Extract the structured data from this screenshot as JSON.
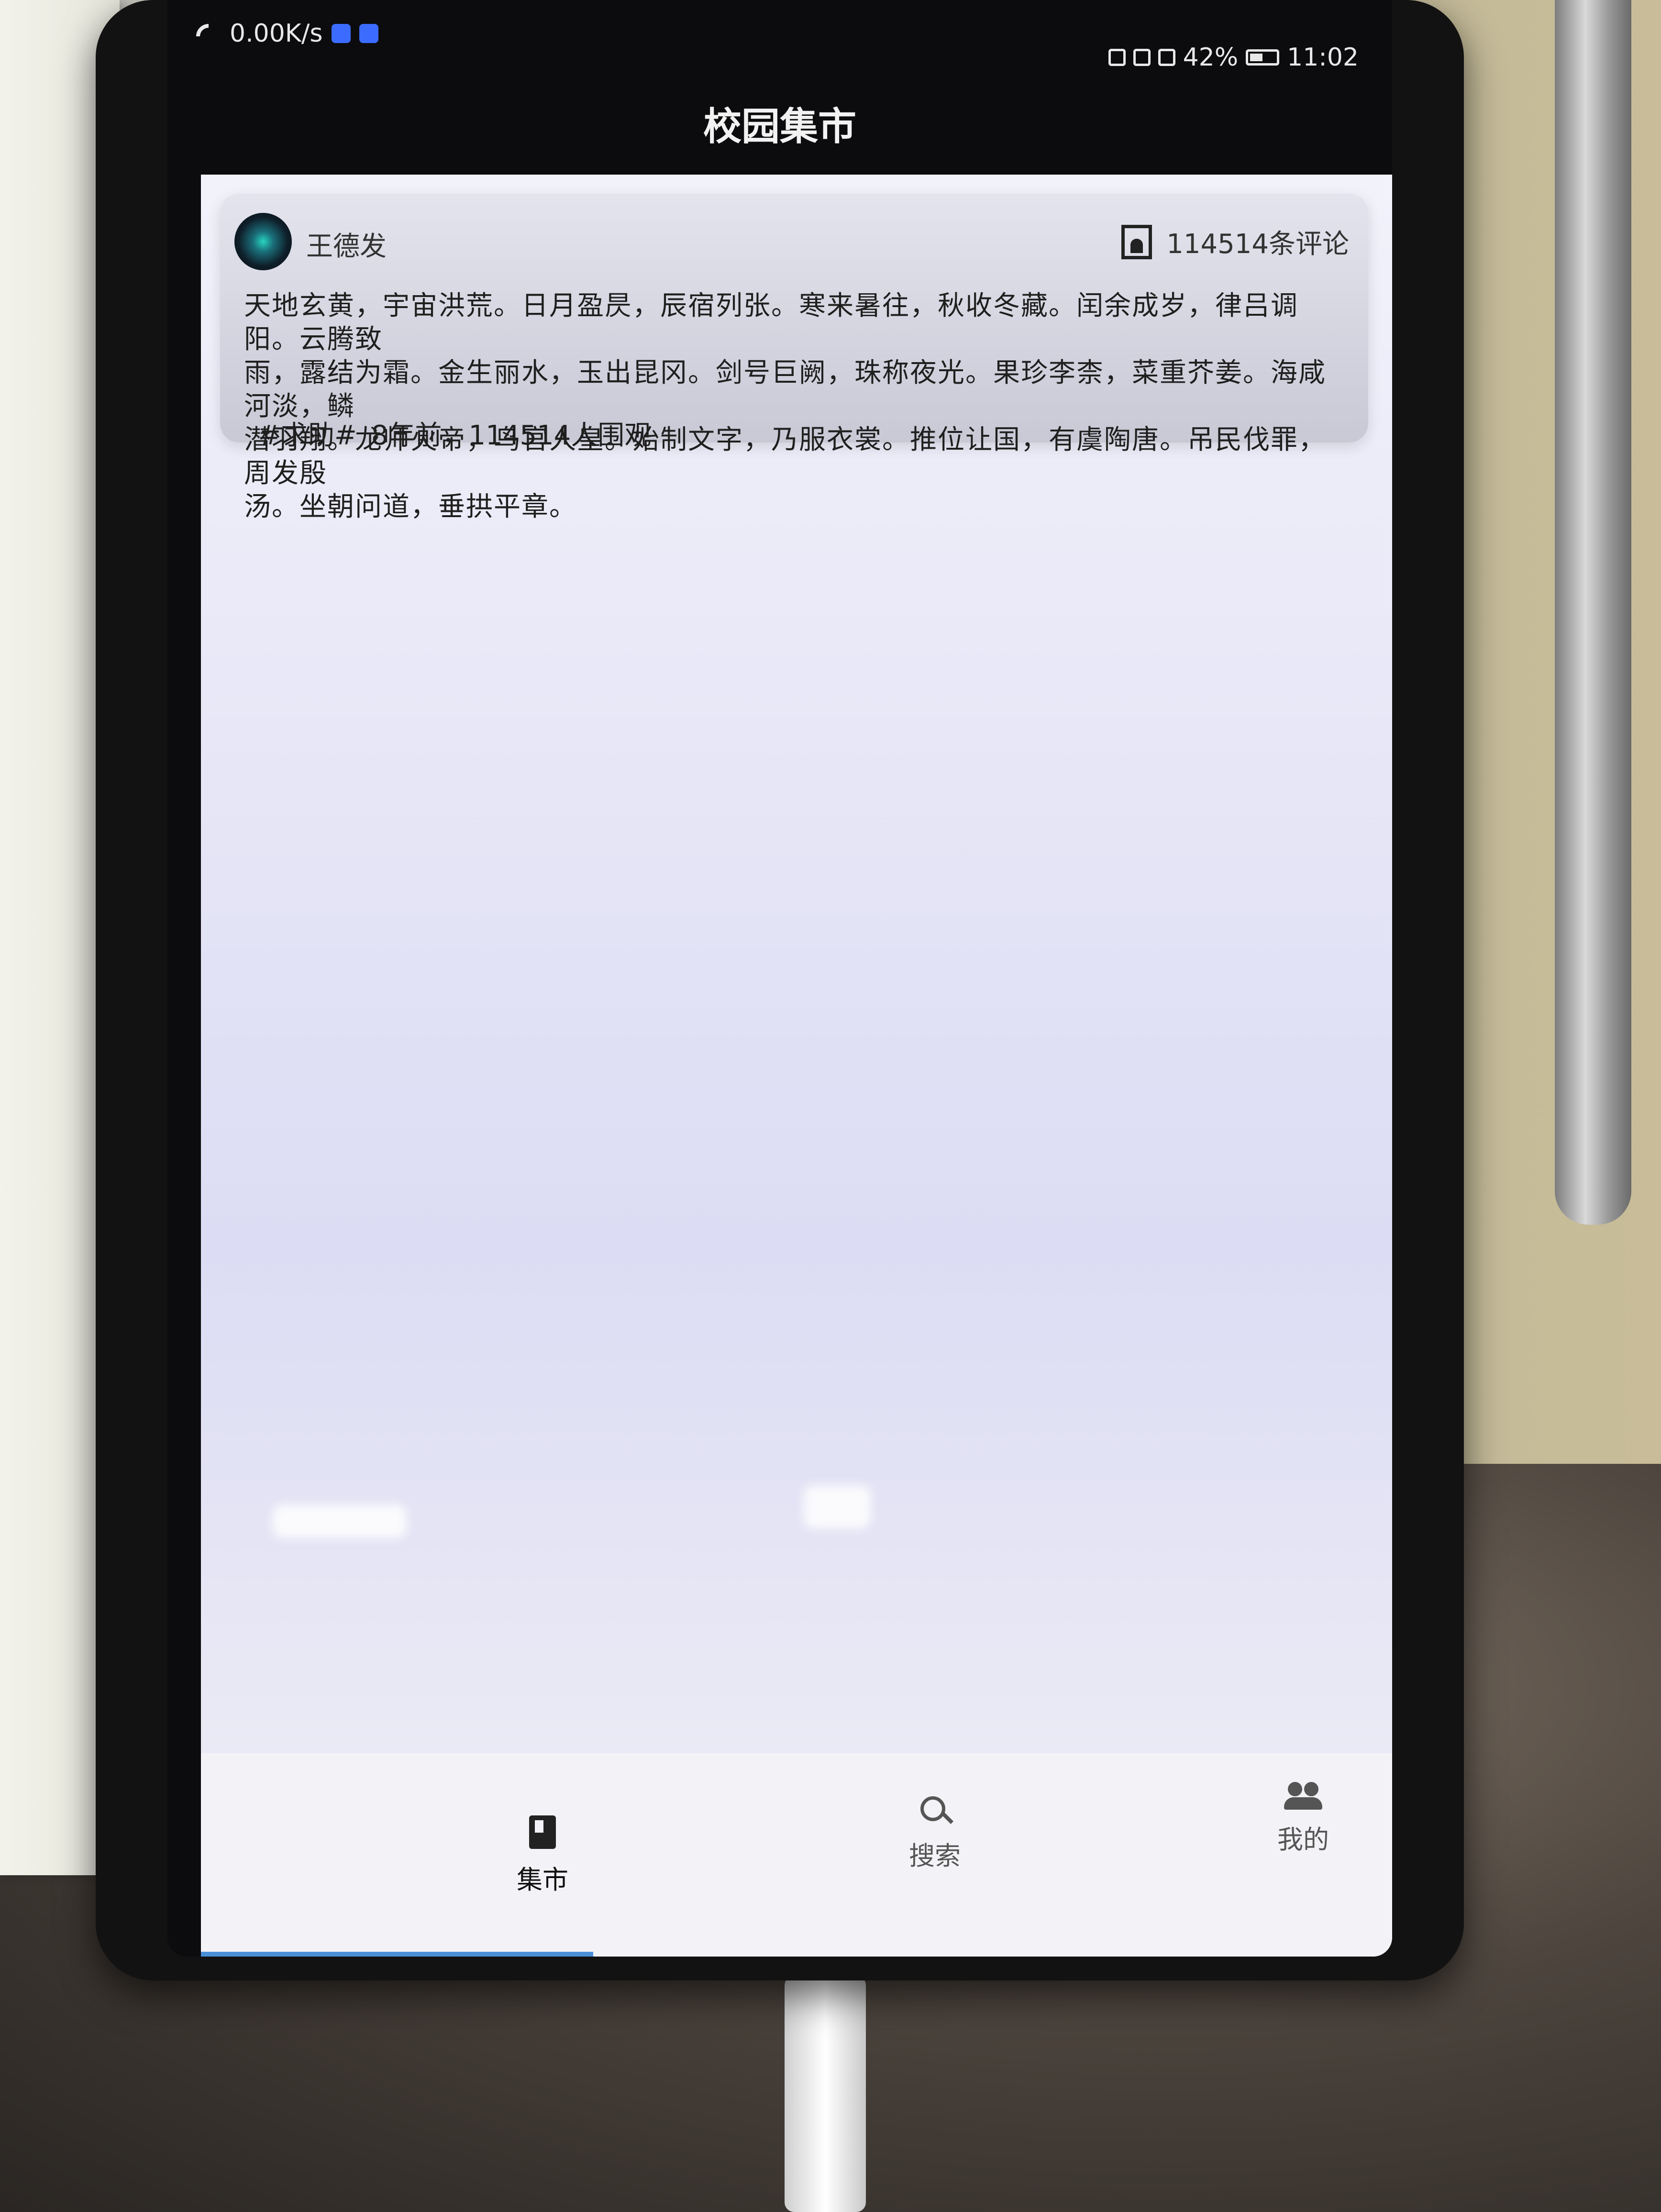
{
  "status_bar": {
    "network_speed": "0.00K/s",
    "battery_percent": "42%",
    "time": "11:02"
  },
  "header": {
    "title": "校园集市"
  },
  "post": {
    "author": "王德发",
    "comment_count": "114514条评论",
    "content_lines": [
      "天地玄黄，宇宙洪荒。日月盈昃，辰宿列张。寒来暑往，秋收冬藏。闰余成岁，律吕调阳。云腾致",
      "雨，露结为霜。金生丽水，玉出昆冈。剑号巨阙，珠称夜光。果珍李柰，菜重芥姜。海咸河淡，鳞",
      "潜羽翔。龙师火帝，鸟官人皇。始制文字，乃服衣裳。推位让国，有虞陶唐。吊民伐罪，周发殷",
      "汤。坐朝问道，垂拱平章。"
    ],
    "tag": "#求助#",
    "meta": "8年前，114514人围观"
  },
  "bottom_nav": {
    "items": [
      {
        "label": "集市",
        "icon": "book-icon",
        "active": true
      },
      {
        "label": "搜索",
        "icon": "search-icon",
        "active": false
      },
      {
        "label": "我的",
        "icon": "people-icon",
        "active": false
      }
    ]
  },
  "colors": {
    "active_tab_underline": "#4a90d9"
  }
}
